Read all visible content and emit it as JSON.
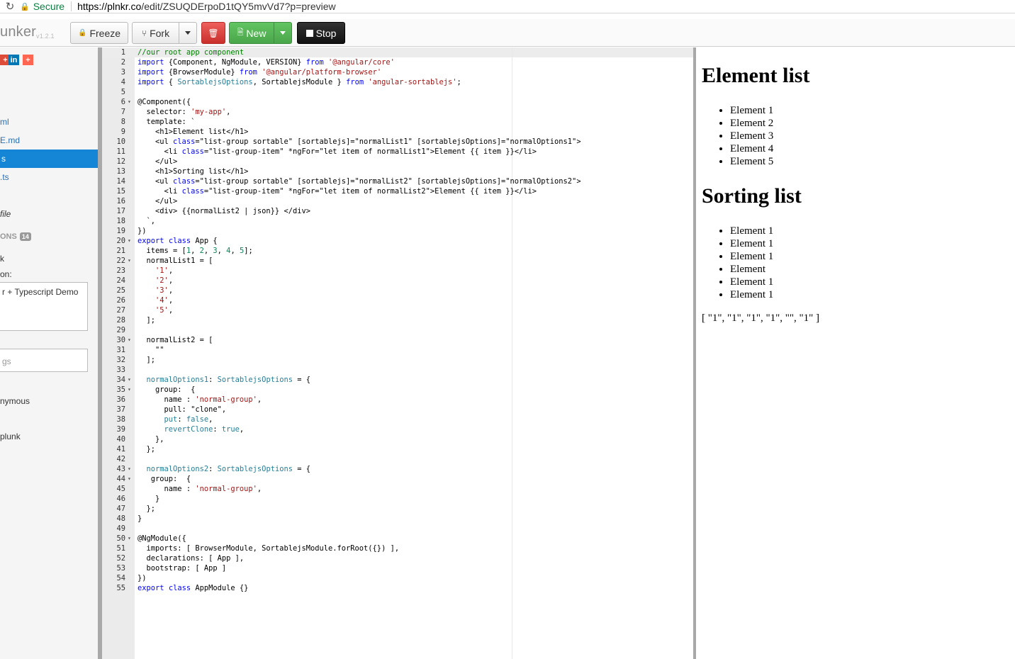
{
  "browser": {
    "secure_label": "Secure",
    "url_host": "https://plnkr.co",
    "url_path": "/edit/ZSUQDErpoD1tQY5mvVd7?p=preview"
  },
  "toolbar": {
    "brand": "unker",
    "version": "v1.2.1",
    "freeze_label": "Freeze",
    "fork_label": "Fork",
    "new_label": "New",
    "stop_label": "Stop"
  },
  "sidebar": {
    "social": [
      "+",
      "in",
      "+"
    ],
    "files": [
      "ml",
      "E.md",
      "s",
      ".ts"
    ],
    "active_file": "s",
    "new_file": "file",
    "options_label": "ONS",
    "options_count": "14",
    "k_label": "k",
    "description_label": "on:",
    "description_value": "r + Typescript Demo",
    "tags_placeholder": "gs",
    "user": "nymous",
    "plunk": "plunk"
  },
  "code": [
    "//our root app component",
    "import {Component, NgModule, VERSION} from '@angular/core'",
    "import {BrowserModule} from '@angular/platform-browser'",
    "import { SortablejsOptions, SortablejsModule } from 'angular-sortablejs';",
    "",
    "@Component({",
    "  selector: 'my-app',",
    "  template: `",
    "    <h1>Element list</h1>",
    "    <ul class=\"list-group sortable\" [sortablejs]=\"normalList1\" [sortablejsOptions]=\"normalOptions1\">",
    "      <li class=\"list-group-item\" *ngFor=\"let item of normalList1\">Element {{ item }}</li>",
    "    </ul>",
    "    <h1>Sorting list</h1>",
    "    <ul class=\"list-group sortable\" [sortablejs]=\"normalList2\" [sortablejsOptions]=\"normalOptions2\">",
    "      <li class=\"list-group-item\" *ngFor=\"let item of normalList2\">Element {{ item }}</li>",
    "    </ul>",
    "    <div> {{normalList2 | json}} </div>",
    "  `,",
    "})",
    "export class App {",
    "  items = [1, 2, 3, 4, 5];",
    "  normalList1 = [",
    "    '1',",
    "    '2',",
    "    '3',",
    "    '4',",
    "    '5',",
    "  ];",
    "",
    "  normalList2 = [",
    "    \"\"",
    "  ];",
    "",
    "  normalOptions1: SortablejsOptions = {",
    "    group:  {",
    "      name : 'normal-group',",
    "      pull: \"clone\",",
    "      put: false,",
    "      revertClone: true,",
    "    },",
    "  };",
    "",
    "  normalOptions2: SortablejsOptions = {",
    "   group:  {",
    "      name : 'normal-group',",
    "    }",
    "  };",
    "}",
    "",
    "@NgModule({",
    "  imports: [ BrowserModule, SortablejsModule.forRoot({}) ],",
    "  declarations: [ App ],",
    "  bootstrap: [ App ]",
    "})",
    "export class AppModule {}"
  ],
  "fold_lines": [
    6,
    20,
    22,
    30,
    34,
    35,
    43,
    44,
    50
  ],
  "preview": {
    "heading1": "Element list",
    "list1": [
      "Element 1",
      "Element 2",
      "Element 3",
      "Element 4",
      "Element 5"
    ],
    "heading2": "Sorting list",
    "list2": [
      "Element 1",
      "Element 1",
      "Element 1",
      "Element",
      "Element 1",
      "Element 1"
    ],
    "json_output": "[ \"1\", \"1\", \"1\", \"1\", \"\", \"1\" ]"
  },
  "colors": {
    "active_file_bg": "#1586d6",
    "new_button": "#5cb85c",
    "delete_button": "#d9534f",
    "stop_button": "#222222",
    "secure": "#0b8043"
  }
}
